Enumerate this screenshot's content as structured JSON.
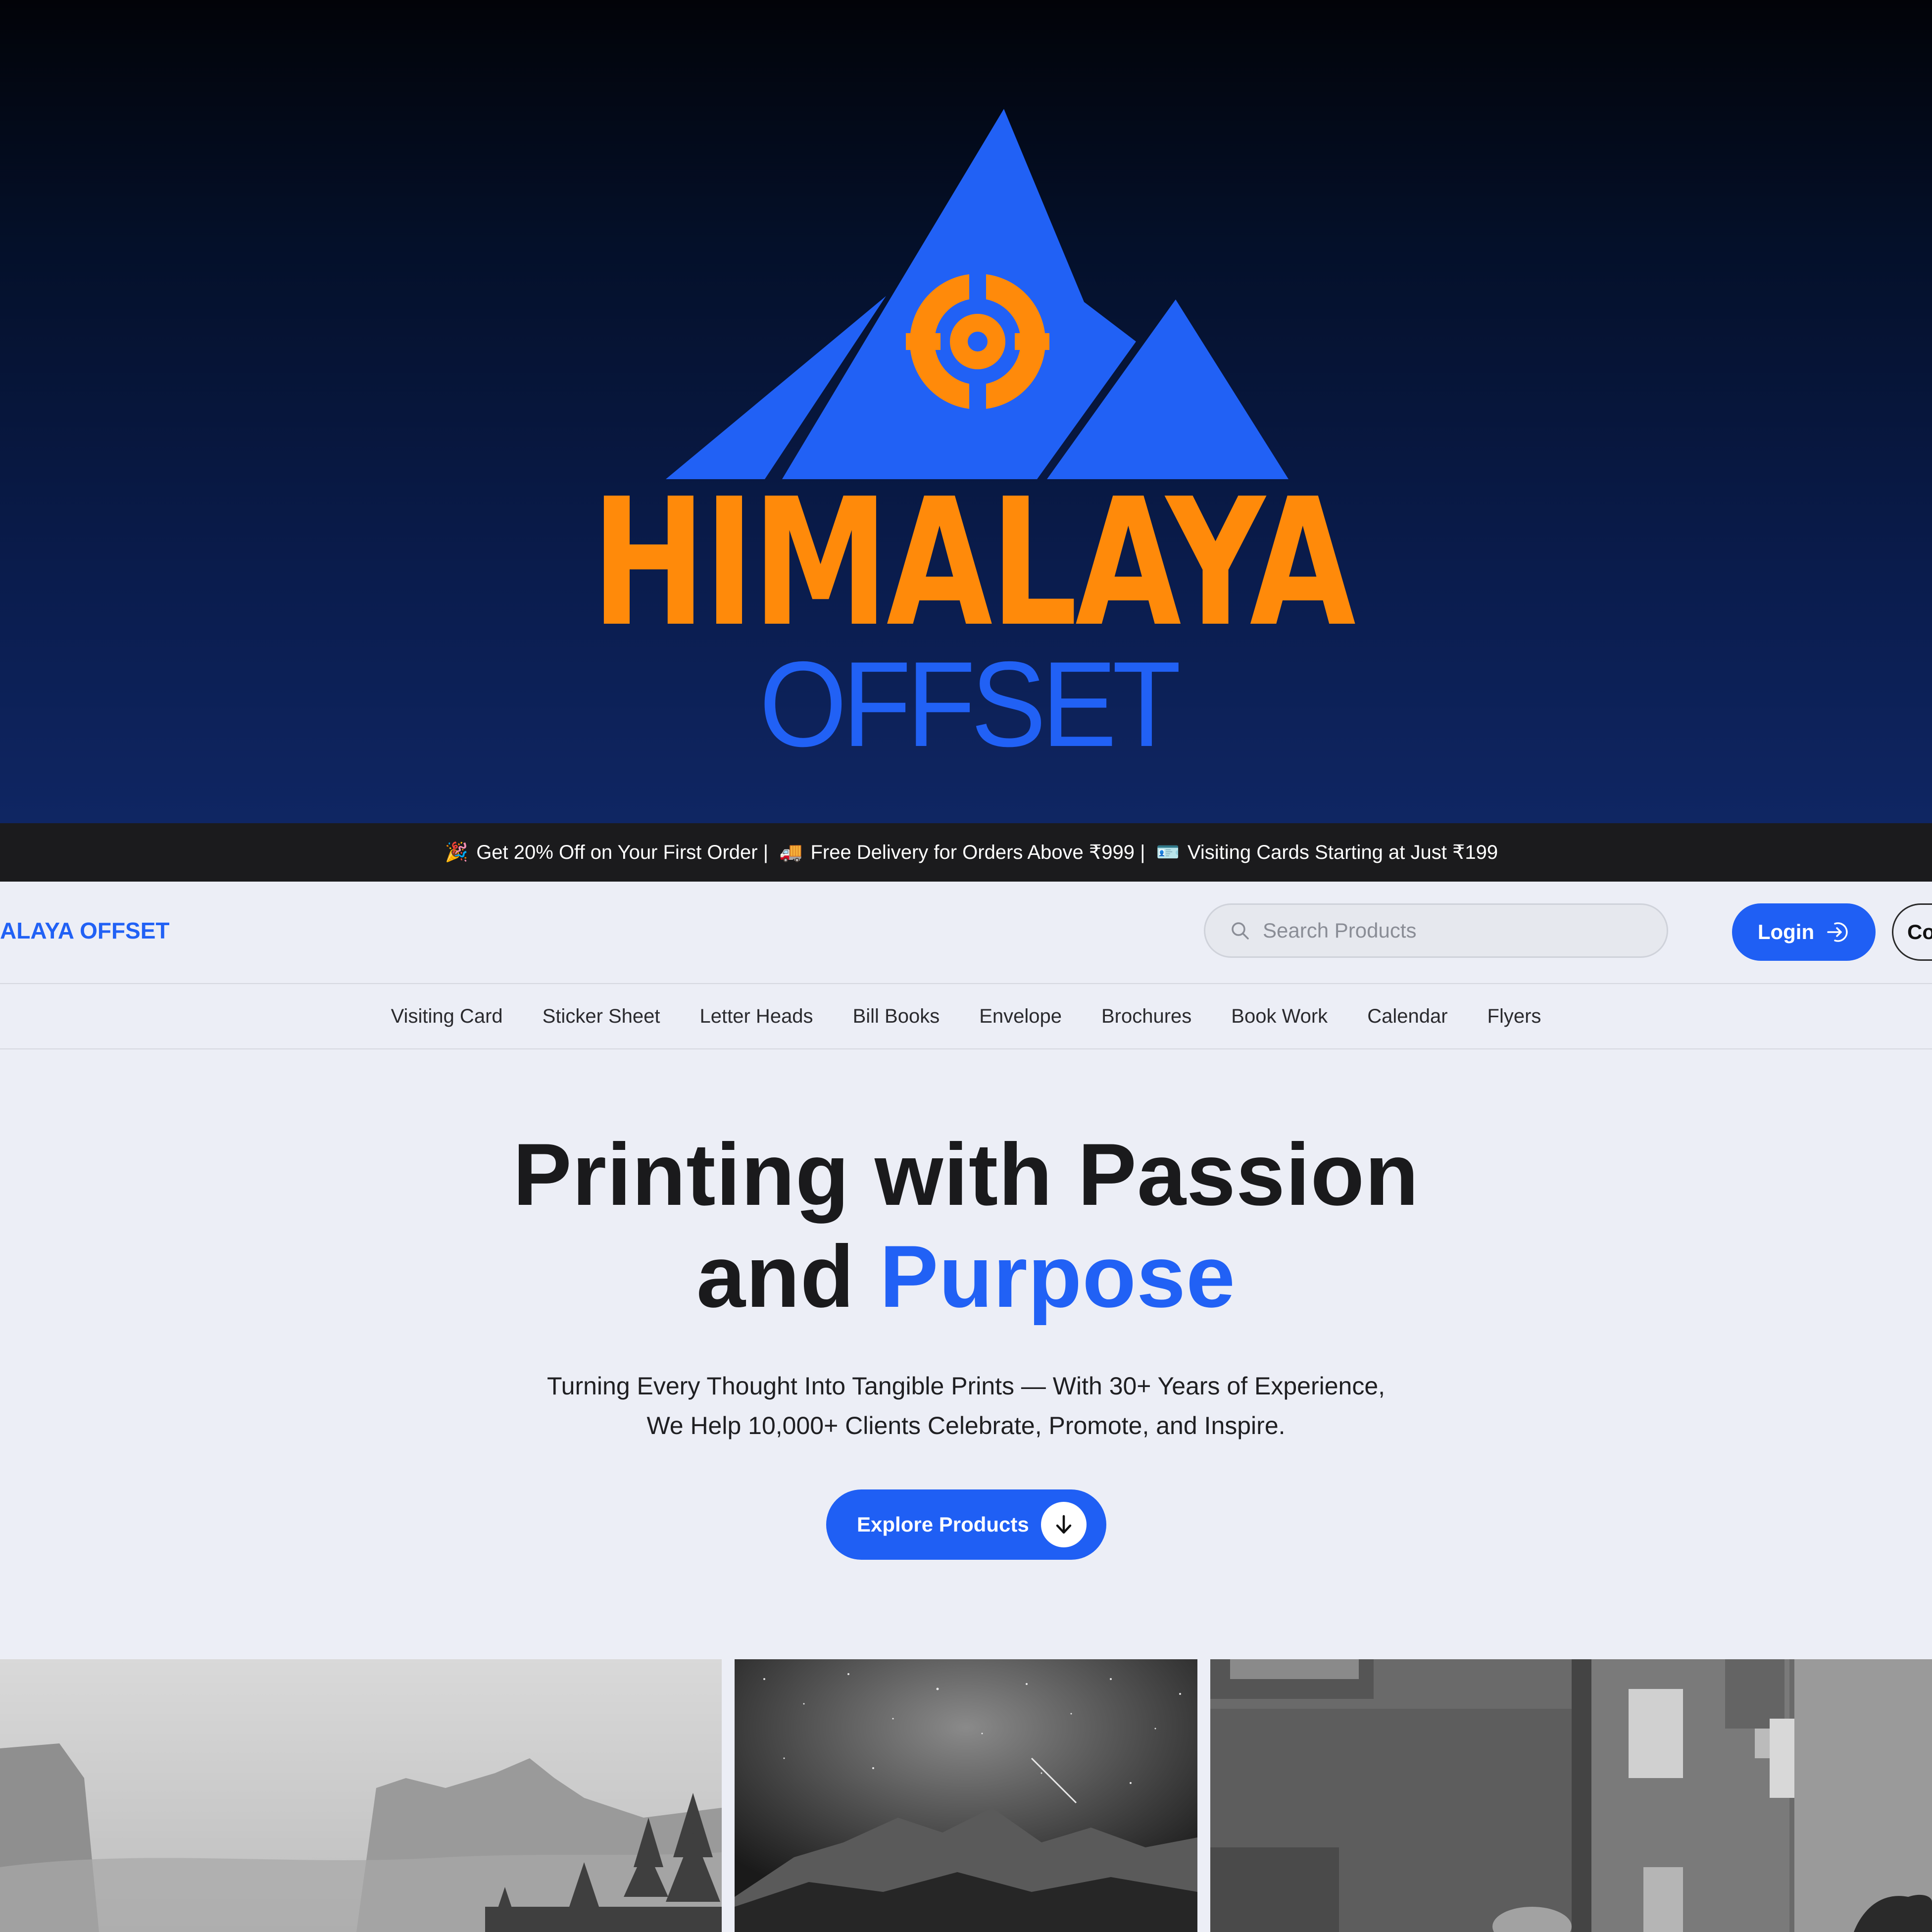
{
  "hero_logo": {
    "word_1": "HIMALAYA",
    "word_2": "OFFSET",
    "colors": {
      "mountain": "#2161f5",
      "emblem": "#ff8a0a",
      "word_1": "#ff8a0a",
      "word_2": "#2161f5"
    }
  },
  "announcement": {
    "items": [
      {
        "icon": "party-popper-icon",
        "glyph": "🎉",
        "text": "Get 20% Off on Your First Order |"
      },
      {
        "icon": "delivery-truck-icon",
        "glyph": "🚚",
        "text": "Free Delivery for Orders Above ₹999 |"
      },
      {
        "icon": "id-card-icon",
        "glyph": "🪪",
        "text": "Visiting Cards Starting at Just ₹199"
      }
    ]
  },
  "header": {
    "brand": "ALAYA OFFSET",
    "search_placeholder": "Search Products",
    "login_label": "Login",
    "contact_label": "Co"
  },
  "nav": {
    "items": [
      "Visiting Card",
      "Sticker Sheet",
      "Letter Heads",
      "Bill Books",
      "Envelope",
      "Brochures",
      "Book Work",
      "Calendar",
      "Flyers"
    ]
  },
  "main": {
    "headline_part1": "Printing with Passion",
    "headline_part2": "and",
    "headline_accent": "Purpose",
    "subline_1": "Turning Every Thought Into Tangible Prints — With 30+ Years of Experience,",
    "subline_2": "We Help 10,000+ Clients Celebrate, Promote, and Inspire.",
    "explore_label": "Explore Products"
  },
  "gallery": {
    "images": [
      "misty-valley-image",
      "starry-mountain-image",
      "modern-house-image"
    ]
  },
  "colors": {
    "accent": "#1f5ff4",
    "announcement_bg": "#1b1b1d",
    "page_bg": "#eceef6",
    "text": "#1a1a1c"
  }
}
